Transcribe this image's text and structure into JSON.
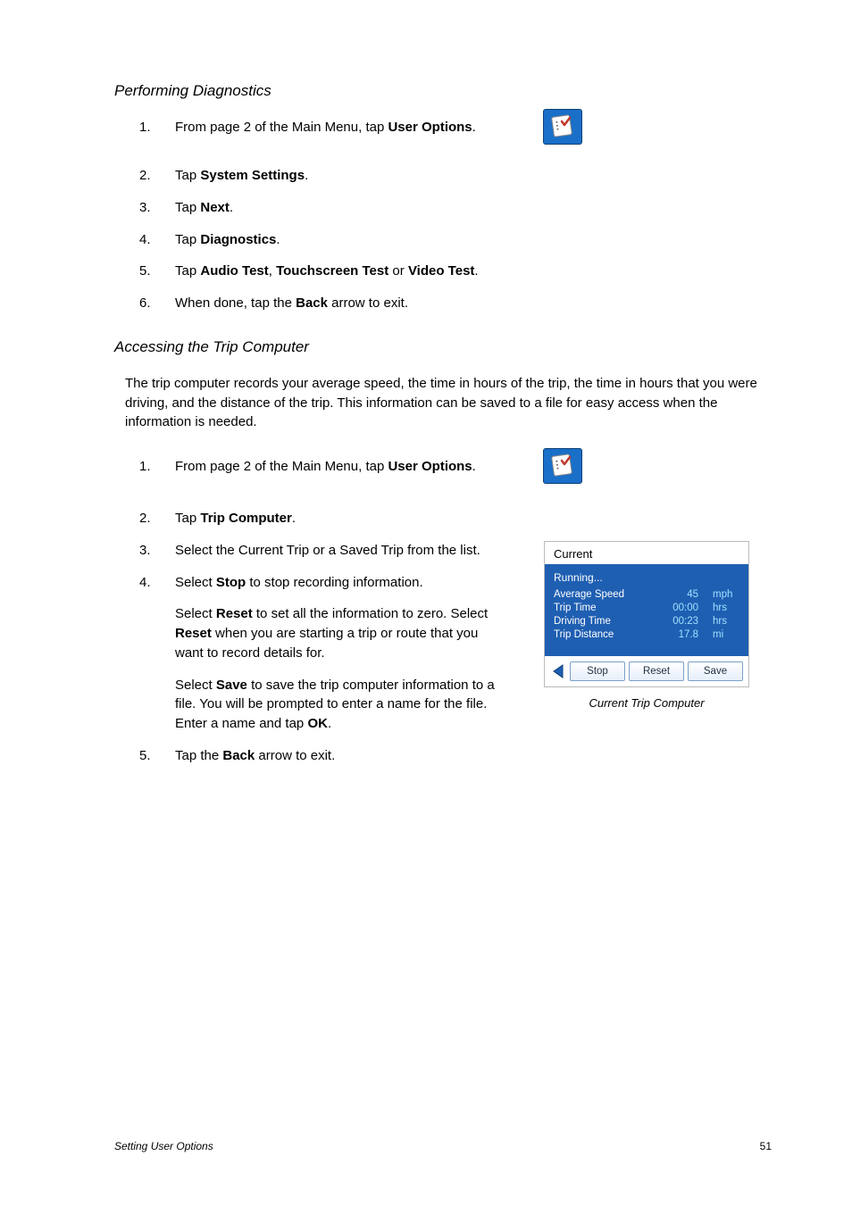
{
  "section1_title": "Performing Diagnostics",
  "section2_title": "Accessing the Trip Computer",
  "section2_desc": "The trip computer records your average speed, the time in hours of the trip, the time in hours that you were driving, and the distance of the trip.  This information can be saved to a file for easy access when the information is needed.",
  "list1": [
    {
      "n": "1.",
      "pre": "From page 2 of the Main Menu, tap ",
      "b": "User Options",
      "post": "."
    },
    {
      "n": "2.",
      "pre": "Tap ",
      "b": "System Settings",
      "post": "."
    },
    {
      "n": "3.",
      "pre": "Tap ",
      "b": "Next",
      "post": "."
    },
    {
      "n": "4.",
      "pre": "Tap ",
      "b": "Diagnostics",
      "post": "."
    },
    {
      "n": "5.",
      "pre": "Tap ",
      "b": "Audio Test",
      "mid1": ", ",
      "b2": "Touchscreen Test",
      "mid2": " or ",
      "b3": "Video Test",
      "post": "."
    },
    {
      "n": "6.",
      "pre": "When done, tap the ",
      "b": "Back",
      "post": " arrow to exit."
    }
  ],
  "list2_item1": {
    "n": "1.",
    "pre": "From page 2 of the Main Menu, tap ",
    "b": "User Options",
    "post": "."
  },
  "list2_item2": {
    "n": "2.",
    "pre": "Tap ",
    "b": "Trip Computer",
    "post": "."
  },
  "list2_item3": {
    "n": "3.",
    "txt": "Select the Current Trip or a Saved Trip from the list."
  },
  "list2_item4": {
    "n": "4.",
    "p1_pre": "Select ",
    "p1_b": "Stop",
    "p1_post": " to stop recording information.",
    "p2_pre": "Select ",
    "p2_b": "Reset",
    "p2_mid": " to set all the information to zero.  Select ",
    "p2_b2": "Reset",
    "p2_post": " when you are starting a trip or route that you want to record details for.",
    "p3_pre": "Select ",
    "p3_b": "Save",
    "p3_mid": " to save the trip computer information to a file.  You will be prompted to enter a name for the file.  Enter a name and tap ",
    "p3_b2": "OK",
    "p3_post": "."
  },
  "list2_item5": {
    "n": "5.",
    "pre": "Tap the ",
    "b": "Back",
    "post": " arrow to exit."
  },
  "trip": {
    "header": "Current",
    "running": "Running...",
    "rows": [
      {
        "l": "Average Speed",
        "v": "45",
        "u": "mph"
      },
      {
        "l": "Trip Time",
        "v": "00:00",
        "u": "hrs"
      },
      {
        "l": "Driving Time",
        "v": "00:23",
        "u": "hrs"
      },
      {
        "l": "Trip Distance",
        "v": "17.8",
        "u": "mi"
      }
    ],
    "btn_stop": "Stop",
    "btn_reset": "Reset",
    "btn_save": "Save",
    "caption": "Current Trip Computer"
  },
  "footer_left": "Setting User Options",
  "footer_right": "51"
}
